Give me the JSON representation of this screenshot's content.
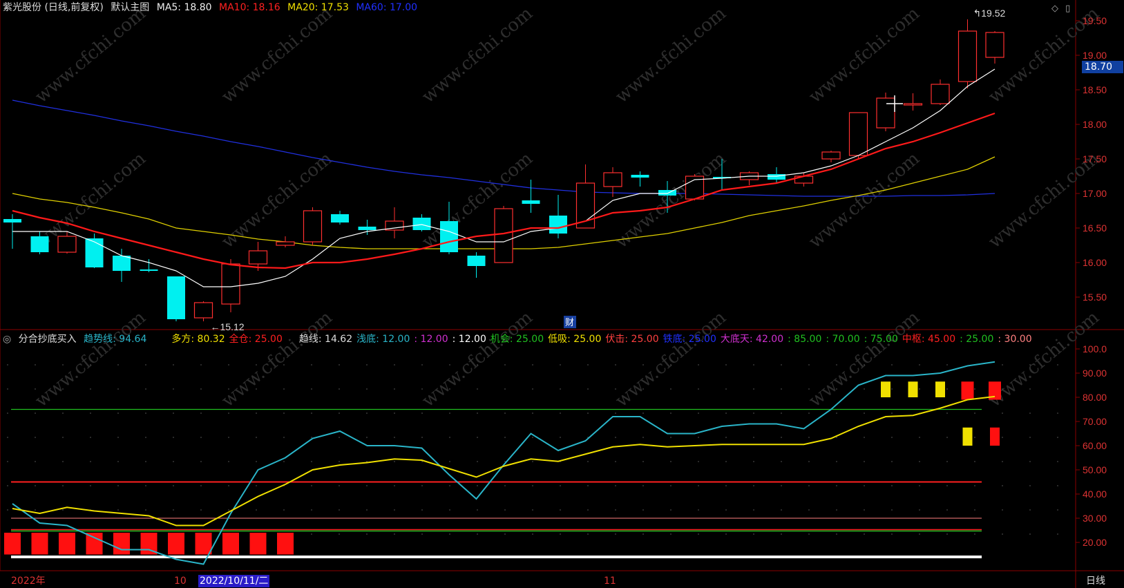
{
  "header": {
    "stock": "紫光股份 (日线,前复权)",
    "layout": "默认主图",
    "ma5": "MA5: 18.80",
    "ma10": "MA10: 18.16",
    "ma20": "MA20: 17.53",
    "ma60": "MA60: 17.00"
  },
  "sub_header": {
    "indicator": "分合抄底买入",
    "items": [
      {
        "text": "趋势线: 94.64",
        "color": "#2ab5c9"
      },
      {
        "text": "多方: 80.32",
        "color": "#f0e000"
      },
      {
        "text": "全仓: 25.00",
        "color": "#ff2020"
      },
      {
        "text": "趋线: 14.62",
        "color": "#dddddd"
      },
      {
        "text": "浅底: 12.00",
        "color": "#2ab5c9"
      },
      {
        "text": ": 12.00",
        "color": "#d030d0"
      },
      {
        "text": ": 12.00",
        "color": "#ffffff"
      },
      {
        "text": "机会: 25.00",
        "color": "#20c020"
      },
      {
        "text": "低吸: 25.00",
        "color": "#f0e000"
      },
      {
        "text": "伏击: 25.00",
        "color": "#ff4040"
      },
      {
        "text": "铁底: 25.00",
        "color": "#2030ff"
      },
      {
        "text": "大底天: 42.00",
        "color": "#d030d0"
      },
      {
        "text": ": 85.00",
        "color": "#20c020"
      },
      {
        "text": ": 70.00",
        "color": "#20c020"
      },
      {
        "text": ": 75.00",
        "color": "#20c020"
      },
      {
        "text": "中枢: 45.00",
        "color": "#ff2020"
      },
      {
        "text": ": 25.00",
        "color": "#20c020"
      },
      {
        "text": ": 30.00",
        "color": "#ff8080"
      }
    ]
  },
  "price_axis": {
    "ticks": [
      "19.50",
      "19.00",
      "18.50",
      "18.00",
      "17.50",
      "17.00",
      "16.50",
      "16.00",
      "15.50"
    ],
    "current": "18.70"
  },
  "indicator_axis": {
    "ticks": [
      "100.0",
      "90.00",
      "80.00",
      "70.00",
      "60.00",
      "50.00",
      "40.00",
      "30.00",
      "20.00"
    ]
  },
  "annotations": {
    "high": "19.52",
    "low": "15.12",
    "fin_marker": "财"
  },
  "time_axis": {
    "year": "2022年",
    "oct": "10",
    "date_cursor": "2022/10/11/二",
    "nov": "11",
    "period": "日线"
  },
  "watermark": "www.cfchi.com",
  "chart_data": {
    "type": "candlestick",
    "candles": [
      {
        "o": 16.63,
        "c": 16.58,
        "h": 16.7,
        "l": 16.2
      },
      {
        "o": 16.38,
        "c": 16.15,
        "h": 16.45,
        "l": 16.12
      },
      {
        "o": 16.15,
        "c": 16.38,
        "h": 16.45,
        "l": 16.13
      },
      {
        "o": 16.35,
        "c": 15.93,
        "h": 16.42,
        "l": 15.92
      },
      {
        "o": 16.1,
        "c": 15.88,
        "h": 16.2,
        "l": 15.72
      },
      {
        "o": 15.9,
        "c": 15.88,
        "h": 16.05,
        "l": 15.86
      },
      {
        "o": 15.8,
        "c": 15.18,
        "h": 15.8,
        "l": 15.15
      },
      {
        "o": 15.2,
        "c": 15.42,
        "h": 15.44,
        "l": 15.15
      },
      {
        "o": 15.4,
        "c": 15.98,
        "h": 16.05,
        "l": 15.28
      },
      {
        "o": 15.98,
        "c": 16.17,
        "h": 16.3,
        "l": 15.88
      },
      {
        "o": 16.25,
        "c": 16.3,
        "h": 16.38,
        "l": 16.22
      },
      {
        "o": 16.3,
        "c": 16.75,
        "h": 16.8,
        "l": 16.25
      },
      {
        "o": 16.7,
        "c": 16.58,
        "h": 16.75,
        "l": 16.55
      },
      {
        "o": 16.52,
        "c": 16.47,
        "h": 16.62,
        "l": 16.4
      },
      {
        "o": 16.47,
        "c": 16.6,
        "h": 16.8,
        "l": 16.35
      },
      {
        "o": 16.65,
        "c": 16.47,
        "h": 16.7,
        "l": 16.45
      },
      {
        "o": 16.6,
        "c": 16.15,
        "h": 16.88,
        "l": 16.12
      },
      {
        "o": 16.1,
        "c": 15.95,
        "h": 16.15,
        "l": 15.78
      },
      {
        "o": 16.0,
        "c": 16.78,
        "h": 16.82,
        "l": 16.0
      },
      {
        "o": 16.9,
        "c": 16.85,
        "h": 17.2,
        "l": 16.72
      },
      {
        "o": 16.68,
        "c": 16.42,
        "h": 16.98,
        "l": 16.35
      },
      {
        "o": 16.5,
        "c": 17.15,
        "h": 17.42,
        "l": 16.5
      },
      {
        "o": 17.1,
        "c": 17.3,
        "h": 17.38,
        "l": 16.95
      },
      {
        "o": 17.27,
        "c": 17.23,
        "h": 17.32,
        "l": 17.1
      },
      {
        "o": 17.05,
        "c": 16.97,
        "h": 17.18,
        "l": 16.72
      },
      {
        "o": 16.92,
        "c": 17.25,
        "h": 17.28,
        "l": 16.9
      },
      {
        "o": 17.24,
        "c": 17.22,
        "h": 17.5,
        "l": 17.05
      },
      {
        "o": 17.2,
        "c": 17.3,
        "h": 17.32,
        "l": 17.12
      },
      {
        "o": 17.28,
        "c": 17.2,
        "h": 17.38,
        "l": 17.15
      },
      {
        "o": 17.15,
        "c": 17.25,
        "h": 17.3,
        "l": 17.1
      },
      {
        "o": 17.5,
        "c": 17.6,
        "h": 17.62,
        "l": 17.45
      },
      {
        "o": 17.55,
        "c": 18.17,
        "h": 18.17,
        "l": 17.5
      },
      {
        "o": 17.95,
        "c": 18.38,
        "h": 18.46,
        "l": 17.9
      },
      {
        "o": 18.3,
        "c": 18.3,
        "h": 18.45,
        "l": 18.2
      },
      {
        "o": 18.3,
        "c": 18.58,
        "h": 18.65,
        "l": 18.28
      },
      {
        "o": 18.62,
        "c": 19.35,
        "h": 19.52,
        "l": 18.52
      },
      {
        "o": 18.97,
        "c": 19.33,
        "h": 19.35,
        "l": 18.88
      }
    ],
    "ma5": [
      16.45,
      16.45,
      16.45,
      16.3,
      16.1,
      16.0,
      15.88,
      15.65,
      15.65,
      15.7,
      15.8,
      16.05,
      16.35,
      16.45,
      16.5,
      16.55,
      16.45,
      16.3,
      16.3,
      16.45,
      16.5,
      16.6,
      16.9,
      17.0,
      17.0,
      17.2,
      17.22,
      17.25,
      17.25,
      17.3,
      17.4,
      17.55,
      17.75,
      17.95,
      18.2,
      18.55,
      18.8
    ],
    "ma10": [
      16.75,
      16.65,
      16.57,
      16.45,
      16.35,
      16.25,
      16.15,
      16.05,
      15.97,
      15.93,
      15.92,
      16.0,
      16.0,
      16.05,
      16.12,
      16.2,
      16.3,
      16.38,
      16.42,
      16.5,
      16.5,
      16.6,
      16.72,
      16.75,
      16.8,
      16.92,
      17.05,
      17.1,
      17.15,
      17.25,
      17.35,
      17.5,
      17.65,
      17.75,
      17.88,
      18.02,
      18.16
    ],
    "ma20": [
      17.0,
      16.92,
      16.87,
      16.8,
      16.72,
      16.63,
      16.5,
      16.45,
      16.4,
      16.34,
      16.3,
      16.25,
      16.22,
      16.2,
      16.2,
      16.2,
      16.2,
      16.2,
      16.2,
      16.2,
      16.22,
      16.27,
      16.32,
      16.37,
      16.42,
      16.5,
      16.58,
      16.68,
      16.75,
      16.82,
      16.9,
      16.97,
      17.05,
      17.15,
      17.25,
      17.35,
      17.53
    ],
    "ma60": [
      18.35,
      18.27,
      18.2,
      18.13,
      18.05,
      17.98,
      17.9,
      17.83,
      17.75,
      17.68,
      17.6,
      17.52,
      17.45,
      17.38,
      17.32,
      17.27,
      17.23,
      17.18,
      17.13,
      17.08,
      17.05,
      17.02,
      17.01,
      17.0,
      17.0,
      17.0,
      16.99,
      16.98,
      16.97,
      16.96,
      16.96,
      16.96,
      16.96,
      16.97,
      16.97,
      16.98,
      17.0
    ],
    "trend": [
      36,
      28,
      27,
      22,
      17,
      17,
      13,
      11,
      32,
      50,
      55,
      63,
      66,
      60,
      60,
      59,
      48,
      38,
      52,
      65,
      58,
      62,
      72,
      72,
      65,
      65,
      68,
      69,
      69,
      67,
      75,
      85,
      89,
      89,
      90,
      93,
      94.64
    ],
    "bulls": [
      34,
      32,
      34.5,
      33,
      32,
      31,
      27,
      27,
      33,
      39,
      44,
      50,
      52,
      53,
      54.5,
      54,
      50.5,
      47,
      51.5,
      54.5,
      53.5,
      56.5,
      59.5,
      60.5,
      59.5,
      60,
      60.5,
      60.5,
      60.5,
      60.5,
      63,
      68,
      72,
      72.5,
      75.5,
      79,
      80.32
    ],
    "signals_bottom": [
      0,
      1,
      2,
      3,
      4,
      5,
      6,
      7,
      8,
      9,
      10
    ],
    "signals_yellow_top": [
      32,
      33,
      34
    ],
    "signals_red_top": [
      35,
      36
    ],
    "signals_yellow_mid": [
      35
    ],
    "signals_red_mid": [
      36
    ],
    "price_ylim": [
      15.12,
      19.75
    ],
    "ind_ylim": [
      14,
      104
    ]
  }
}
